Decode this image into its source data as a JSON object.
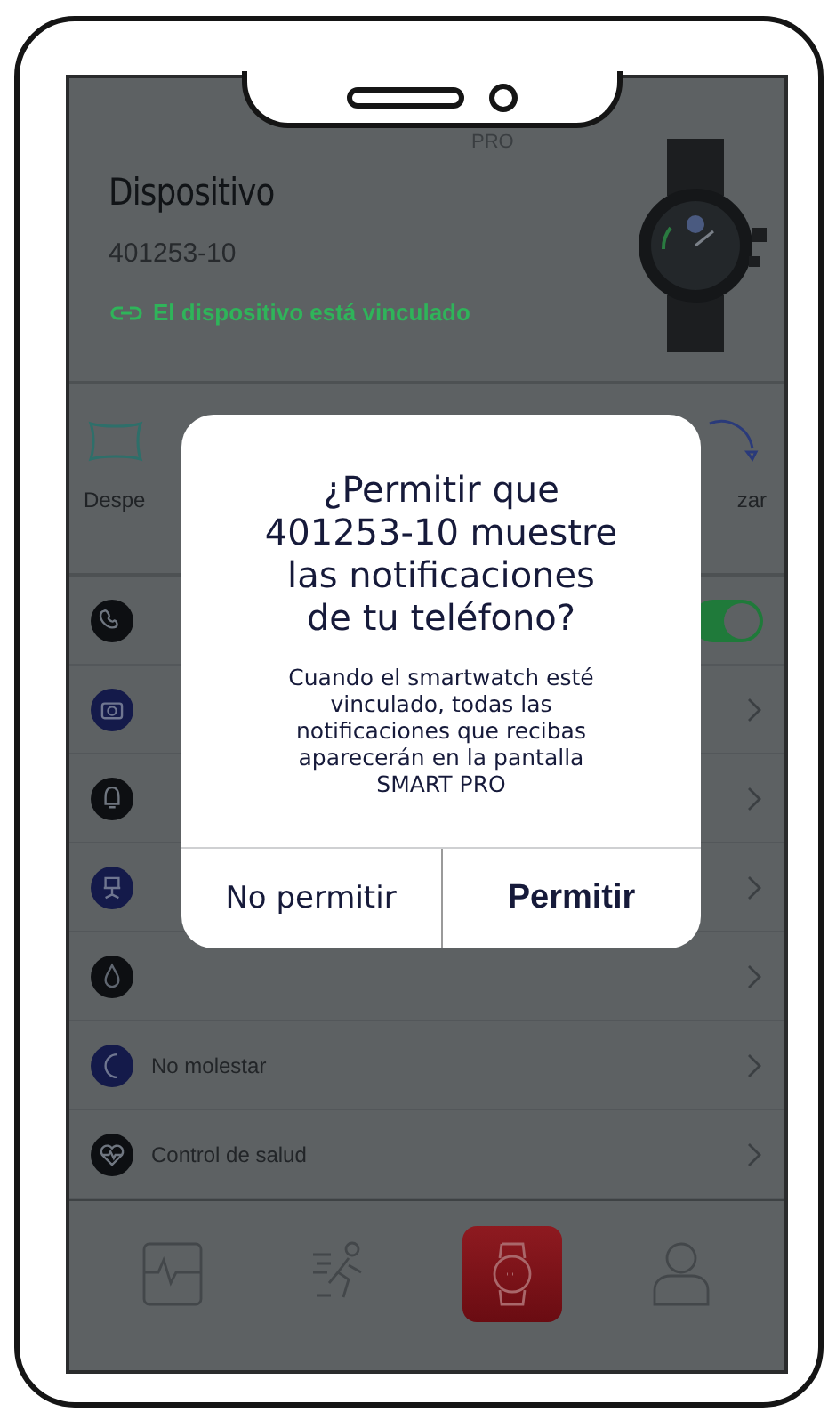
{
  "device": {
    "header": "PRO",
    "title": "Dispositivo",
    "model": "401253-10",
    "status": "El dispositivo está vinculado",
    "linked": true
  },
  "shortcuts": [
    {
      "label": "Despe"
    },
    {
      "label": "zar"
    }
  ],
  "settings": [
    {
      "kind": "toggle",
      "on": true
    },
    {
      "kind": "link"
    },
    {
      "kind": "link"
    },
    {
      "kind": "link"
    },
    {
      "kind": "link"
    },
    {
      "kind": "link",
      "label": "No molestar"
    },
    {
      "kind": "link",
      "label": "Control de salud"
    }
  ],
  "nav": [
    {
      "selected": false
    },
    {
      "selected": false
    },
    {
      "selected": true
    },
    {
      "selected": false
    }
  ],
  "dialog": {
    "title_lines": [
      "¿Permitir que",
      "401253-10 muestre",
      "las notificaciones",
      "de tu teléfono?"
    ],
    "message_lines": [
      "Cuando el smartwatch esté",
      "vinculado, todas las",
      "notificaciones que recibas",
      "aparecerán en la pantalla",
      "SMART PRO"
    ],
    "buttons": [
      {
        "label": "No permitir",
        "primary": false
      },
      {
        "label": "Permitir",
        "primary": true
      }
    ]
  }
}
